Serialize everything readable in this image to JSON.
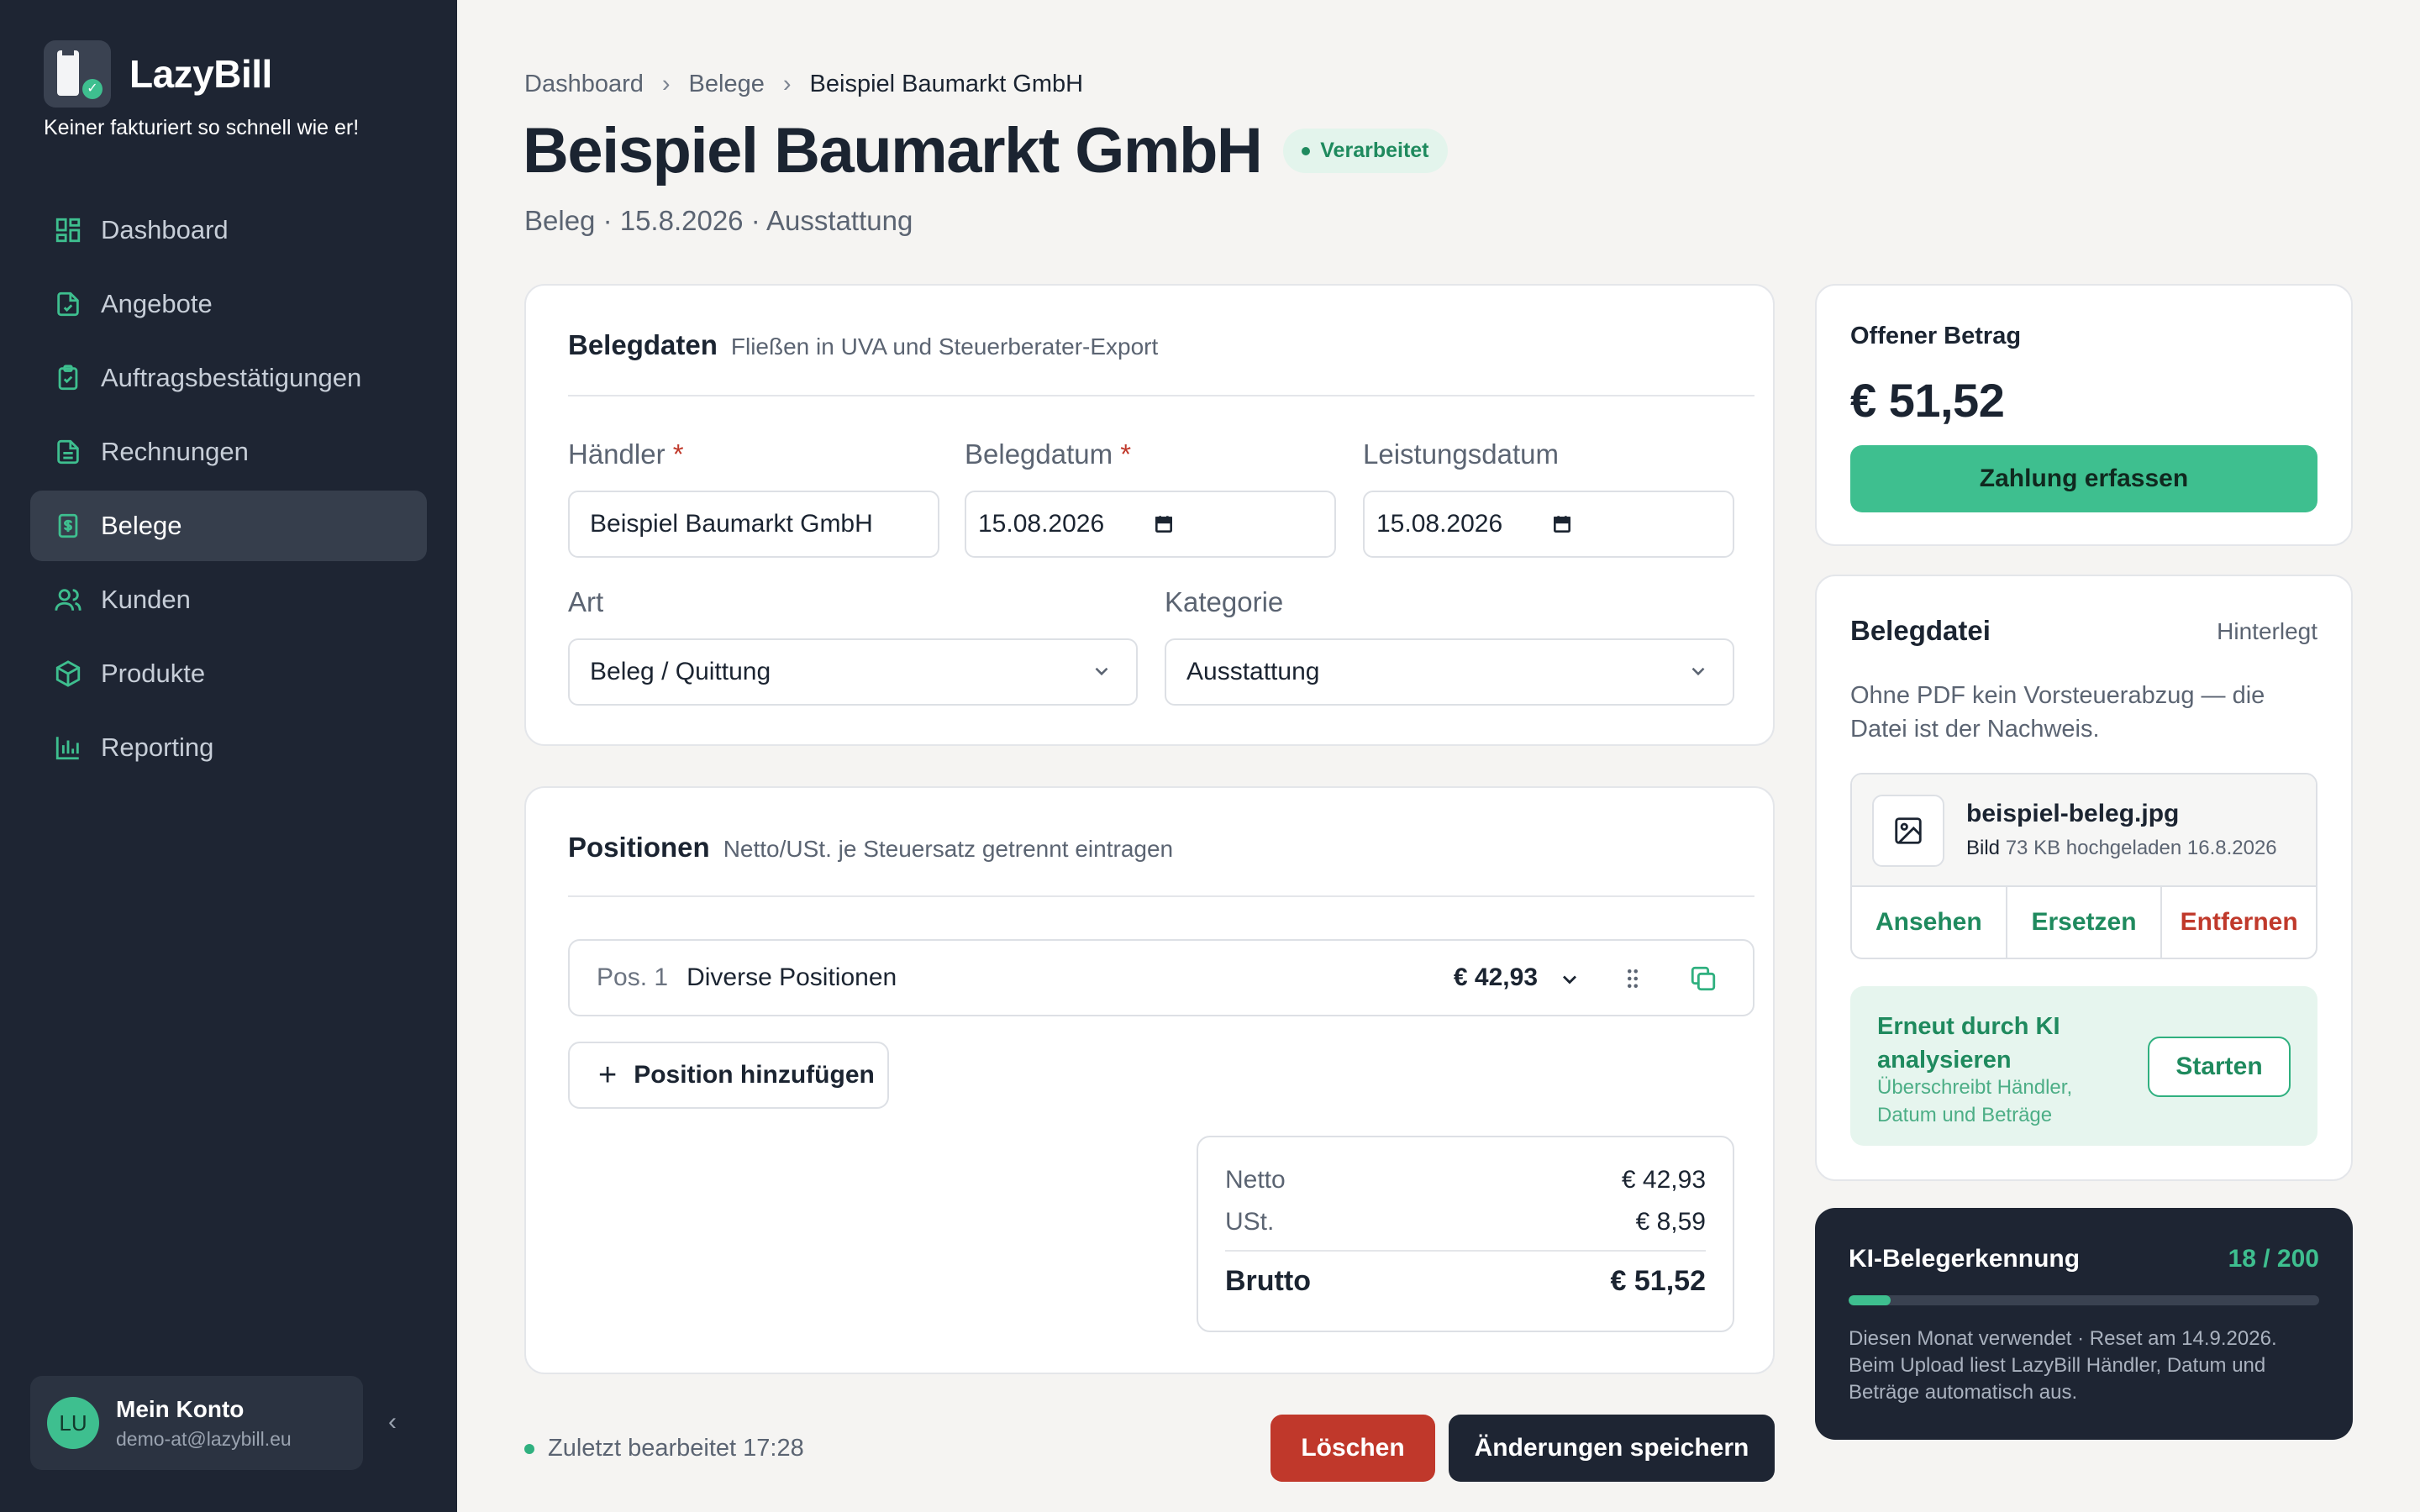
{
  "app": {
    "name": "LazyBill",
    "tagline": "Keiner fakturiert so schnell wie er!"
  },
  "sidebar": {
    "items": [
      {
        "label": "Dashboard",
        "icon": "dashboard-icon"
      },
      {
        "label": "Angebote",
        "icon": "offer-document-icon"
      },
      {
        "label": "Auftragsbestätigungen",
        "icon": "clipboard-check-icon"
      },
      {
        "label": "Rechnungen",
        "icon": "invoice-icon"
      },
      {
        "label": "Belege",
        "icon": "receipt-icon",
        "active": true
      },
      {
        "label": "Kunden",
        "icon": "users-icon"
      },
      {
        "label": "Produkte",
        "icon": "box-icon"
      },
      {
        "label": "Reporting",
        "icon": "bar-chart-icon"
      }
    ],
    "account": {
      "initials": "LU",
      "name": "Mein Konto",
      "email": "demo-at@lazybill.eu"
    }
  },
  "breadcrumb": [
    "Dashboard",
    "Belege",
    "Beispiel Baumarkt GmbH"
  ],
  "header": {
    "title": "Beispiel Baumarkt GmbH",
    "status": "Verarbeitet",
    "subtitle": "Beleg · 15.8.2026 · Ausstattung"
  },
  "belegdaten": {
    "title": "Belegdaten",
    "hint": "Fließen in UVA und Steuerberater-Export",
    "haendler_label": "Händler",
    "haendler_value": "Beispiel Baumarkt GmbH",
    "belegdatum_label": "Belegdatum",
    "belegdatum_value": "15.08.2026",
    "leistungsdatum_label": "Leistungsdatum",
    "leistungsdatum_value": "15.08.2026",
    "art_label": "Art",
    "art_value": "Beleg / Quittung",
    "kategorie_label": "Kategorie",
    "kategorie_value": "Ausstattung",
    "required_mark": "*"
  },
  "positionen": {
    "title": "Positionen",
    "hint": "Netto/USt. je Steuersatz getrennt eintragen",
    "rows": [
      {
        "num": "Pos. 1",
        "name": "Diverse Positionen",
        "amount": "€ 42,93"
      }
    ],
    "add_label": "Position hinzufügen",
    "totals": {
      "netto_label": "Netto",
      "netto_value": "€ 42,93",
      "ust_label": "USt.",
      "ust_value": "€ 8,59",
      "brutto_label": "Brutto",
      "brutto_value": "€ 51,52"
    }
  },
  "footer": {
    "status": "Zuletzt bearbeitet 17:28",
    "delete_label": "Löschen",
    "save_label": "Änderungen speichern"
  },
  "open_amount": {
    "label": "Offener Betrag",
    "value": "€ 51,52",
    "pay_label": "Zahlung erfassen"
  },
  "belegdatei": {
    "title": "Belegdatei",
    "state": "Hinterlegt",
    "description": "Ohne PDF kein Vorsteuerabzug — die Datei ist der Nachweis.",
    "file_name": "beispiel-beleg.jpg",
    "file_type": "Bild",
    "file_meta": "73 KB hochgeladen 16.8.2026",
    "view_label": "Ansehen",
    "replace_label": "Ersetzen",
    "remove_label": "Entfernen",
    "ai_title": "Erneut durch KI analysieren",
    "ai_sub": "Überschreibt Händler, Datum und Beträge",
    "ai_start_label": "Starten"
  },
  "ai_usage": {
    "title": "KI-Belegerkennung",
    "count": "18 / 200",
    "used_fraction": 0.09,
    "note": "Diesen Monat verwendet · Reset am 14.9.2026. Beim Upload liest LazyBill Händler, Datum und Beträge automatisch aus."
  },
  "colors": {
    "sidebar_bg": "#1e2533",
    "accent": "#3ebf8f",
    "accent_dark": "#1f8a5e",
    "danger": "#c0382b"
  }
}
